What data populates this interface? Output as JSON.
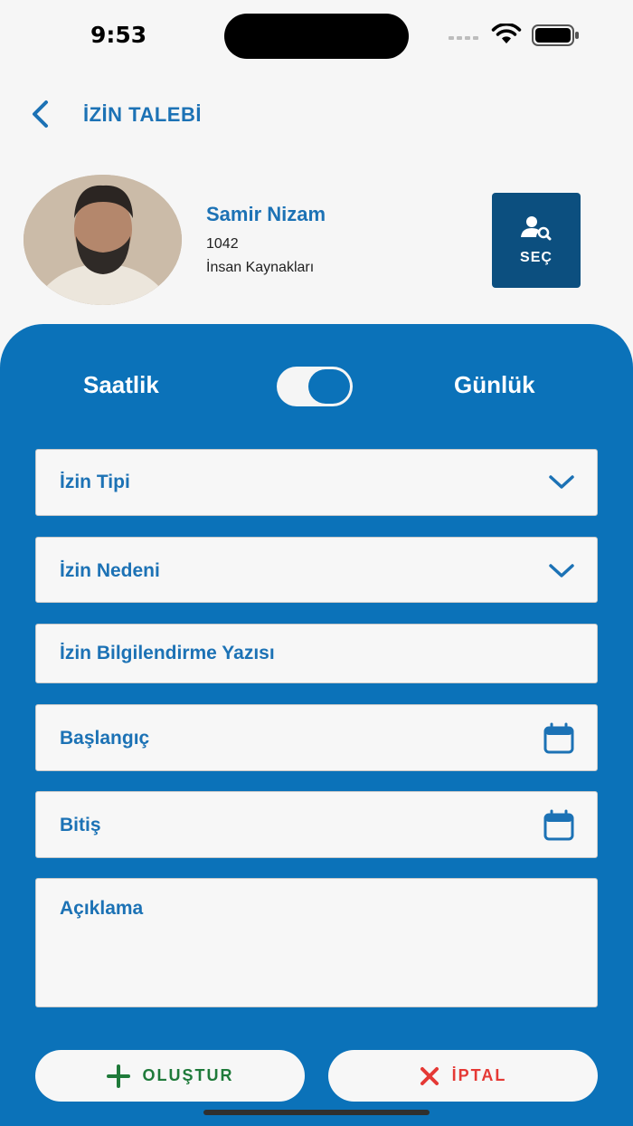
{
  "status_bar": {
    "time": "9:53"
  },
  "header": {
    "title": "İZİN TALEBİ"
  },
  "profile": {
    "name": "Samir Nizam",
    "id": "1042",
    "department": "İnsan Kaynakları",
    "select_label": "SEÇ"
  },
  "mode_toggle": {
    "left_label": "Saatlik",
    "right_label": "Günlük",
    "selected": "Günlük"
  },
  "form": {
    "leave_type": "İzin Tipi",
    "leave_reason": "İzin Nedeni",
    "info_text": "İzin Bilgilendirme Yazısı",
    "start": "Başlangıç",
    "end": "Bitiş",
    "description": "Açıklama"
  },
  "actions": {
    "create_label": "OLUŞTUR",
    "cancel_label": "İPTAL"
  },
  "colors": {
    "primary": "#0b72b9",
    "title": "#1c72b5",
    "create": "#1f7a3a",
    "cancel": "#e53935",
    "select_button": "#0c4f7f"
  }
}
